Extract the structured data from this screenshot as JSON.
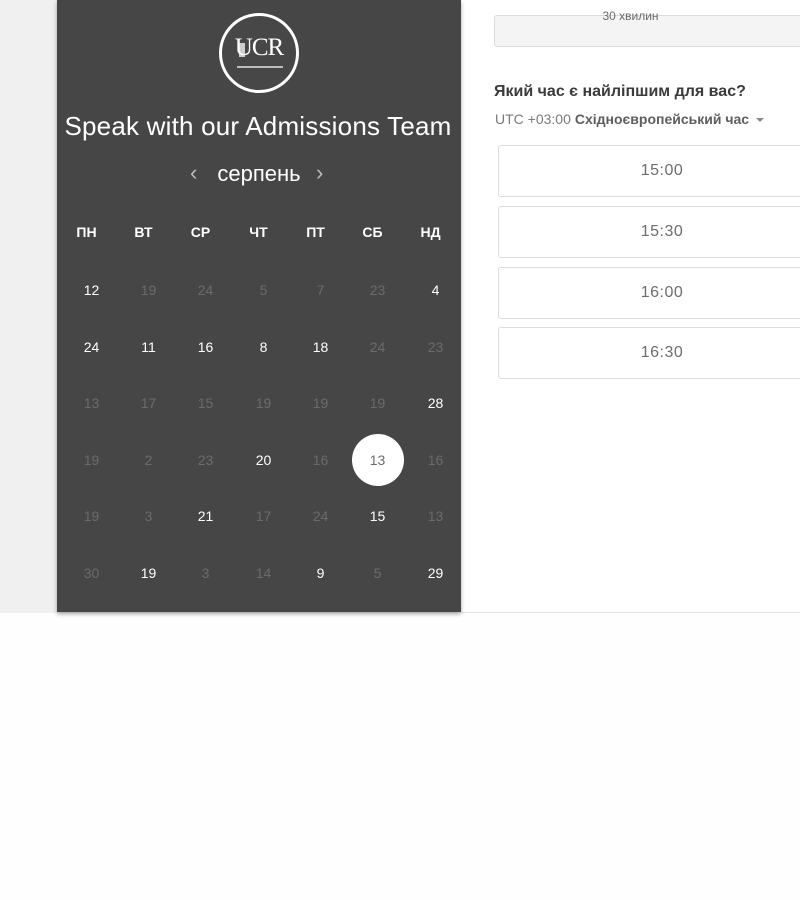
{
  "duration": "30 хвилин",
  "question": "Який час є найліпшим для вас?",
  "timezone": {
    "offset": "UTC +03:00",
    "name": "Східноєвропейський час"
  },
  "time_slots": [
    "15:00",
    "15:30",
    "16:00",
    "16:30"
  ],
  "calendar": {
    "logo_text": "UCR",
    "title": "Speak with our Admissions Team",
    "month": "серпень",
    "prev_icon": "‹",
    "next_icon": "›",
    "weekdays": [
      "ПН",
      "ВТ",
      "СР",
      "ЧТ",
      "ПТ",
      "СБ",
      "НД"
    ],
    "weeks": [
      [
        {
          "d": "12",
          "s": "active"
        },
        {
          "d": "19",
          "s": "inactive"
        },
        {
          "d": "24",
          "s": "inactive"
        },
        {
          "d": "5",
          "s": "inactive"
        },
        {
          "d": "7",
          "s": "inactive"
        },
        {
          "d": "23",
          "s": "inactive"
        },
        {
          "d": "4",
          "s": "active"
        }
      ],
      [
        {
          "d": "24",
          "s": "active"
        },
        {
          "d": "11",
          "s": "active"
        },
        {
          "d": "16",
          "s": "active"
        },
        {
          "d": "8",
          "s": "active"
        },
        {
          "d": "18",
          "s": "active"
        },
        {
          "d": "24",
          "s": "inactive"
        },
        {
          "d": "23",
          "s": "inactive"
        }
      ],
      [
        {
          "d": "13",
          "s": "inactive"
        },
        {
          "d": "17",
          "s": "inactive"
        },
        {
          "d": "15",
          "s": "inactive"
        },
        {
          "d": "19",
          "s": "inactive"
        },
        {
          "d": "19",
          "s": "inactive"
        },
        {
          "d": "19",
          "s": "inactive"
        },
        {
          "d": "28",
          "s": "active"
        }
      ],
      [
        {
          "d": "19",
          "s": "inactive"
        },
        {
          "d": "2",
          "s": "inactive"
        },
        {
          "d": "23",
          "s": "inactive"
        },
        {
          "d": "20",
          "s": "active"
        },
        {
          "d": "16",
          "s": "inactive"
        },
        {
          "d": "13",
          "s": "selected"
        },
        {
          "d": "16",
          "s": "inactive"
        }
      ],
      [
        {
          "d": "19",
          "s": "inactive"
        },
        {
          "d": "3",
          "s": "inactive"
        },
        {
          "d": "21",
          "s": "active"
        },
        {
          "d": "17",
          "s": "inactive"
        },
        {
          "d": "24",
          "s": "inactive"
        },
        {
          "d": "15",
          "s": "active"
        },
        {
          "d": "13",
          "s": "inactive"
        }
      ],
      [
        {
          "d": "30",
          "s": "inactive"
        },
        {
          "d": "19",
          "s": "active"
        },
        {
          "d": "3",
          "s": "inactive"
        },
        {
          "d": "14",
          "s": "inactive"
        },
        {
          "d": "9",
          "s": "active"
        },
        {
          "d": "5",
          "s": "inactive"
        },
        {
          "d": "29",
          "s": "active"
        }
      ]
    ]
  },
  "colors": {
    "calendar_bg": "#464646",
    "page_bg": "#f0f0f0",
    "active_day": "#ffffff",
    "inactive_day": "#6b6b6b",
    "selected_bg": "#ffffff"
  }
}
